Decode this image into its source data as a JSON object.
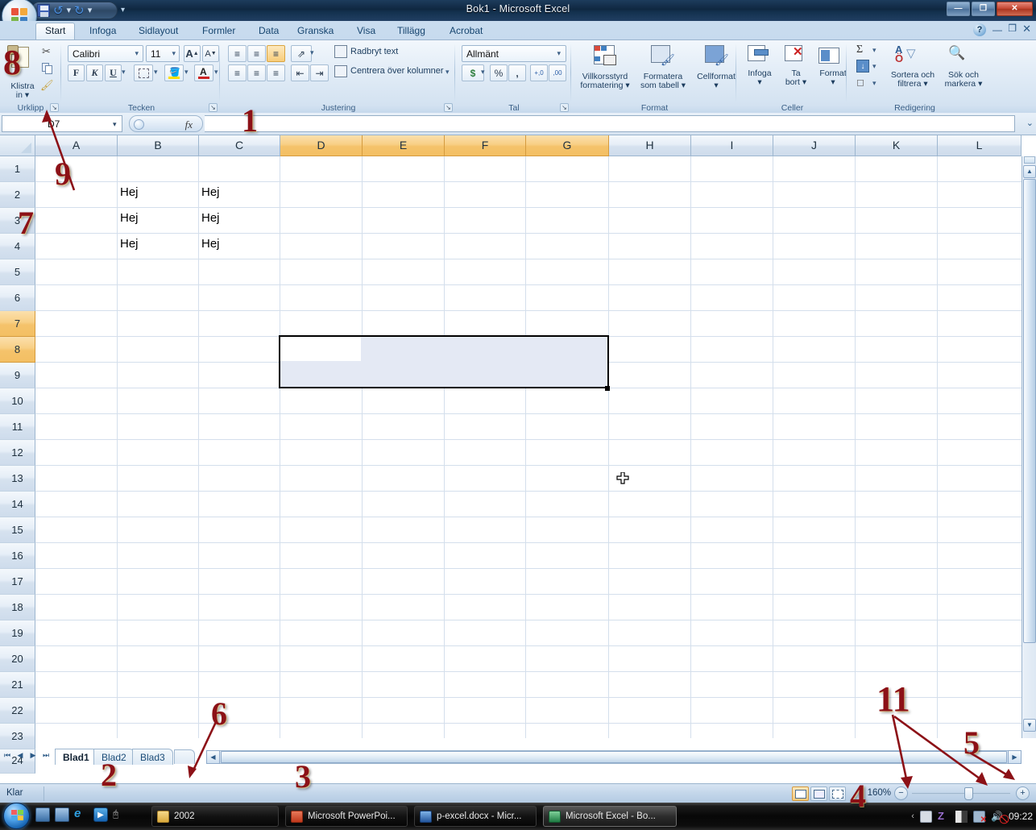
{
  "window": {
    "title": "Bok1 - Microsoft Excel",
    "minimize": "—",
    "restore": "❐",
    "close": "✕"
  },
  "quick_access": {
    "office_button": "Office-knappen",
    "save": "save-icon",
    "undo": "undo-icon",
    "redo": "redo-icon",
    "customize": "customize-icon"
  },
  "ribbon": {
    "tabs": [
      {
        "label": "Start",
        "active": true
      },
      {
        "label": "Infoga",
        "active": false
      },
      {
        "label": "Sidlayout",
        "active": false
      },
      {
        "label": "Formler",
        "active": false
      },
      {
        "label": "Data",
        "active": false
      },
      {
        "label": "Granska",
        "active": false
      },
      {
        "label": "Visa",
        "active": false
      },
      {
        "label": "Tillägg",
        "active": false
      },
      {
        "label": "Acrobat",
        "active": false
      }
    ],
    "help_icon": "?",
    "minimize_ribbon": "—",
    "restore_ribbon": "❐",
    "close_ribbon": "✕",
    "groups": [
      {
        "name": "Urklipp",
        "label": "Urklipp"
      },
      {
        "name": "Tecken",
        "label": "Tecken"
      },
      {
        "name": "Justering",
        "label": "Justering"
      },
      {
        "name": "Tal",
        "label": "Tal"
      },
      {
        "name": "Format",
        "label": "Format"
      },
      {
        "name": "Celler",
        "label": "Celler"
      },
      {
        "name": "Redigering",
        "label": "Redigering"
      }
    ],
    "clipboard": {
      "paste_line1": "Klistra",
      "paste_line2": "in",
      "cut": "cut-icon",
      "copy": "copy-icon",
      "format_painter": "format-painter-icon"
    },
    "font": {
      "font_name": "Calibri",
      "font_size": "11",
      "grow_font": "A",
      "shrink_font": "A",
      "bold": "F",
      "italic": "K",
      "underline": "U",
      "borders": "borders-icon",
      "fill_color": "fill-color-icon",
      "font_color": "A"
    },
    "alignment": {
      "wrap_text": "Radbryt text",
      "merge_center": "Centrera över kolumner",
      "orientation": "orientation-icon",
      "decrease_indent": "decrease-indent-icon",
      "increase_indent": "increase-indent-icon"
    },
    "number": {
      "format": "Allmänt",
      "currency": "$",
      "percent": "%",
      "comma": ",",
      "increase_decimals": "+,0",
      "decrease_decimals": ",00"
    },
    "styles": {
      "conditional_line1": "Villkorsstyrd",
      "conditional_line2": "formatering",
      "table_line1": "Formatera",
      "table_line2": "som tabell",
      "cell_styles": "Cellformat"
    },
    "cells": {
      "insert": "Infoga",
      "delete_line1": "Ta",
      "delete_line2": "bort",
      "format": "Format"
    },
    "editing": {
      "autosum": "Σ",
      "fill": "fill-icon",
      "clear": "clear-icon",
      "sort_line1": "Sortera och",
      "sort_line2": "filtrera",
      "find_line1": "Sök och",
      "find_line2": "markera"
    }
  },
  "formula_bar": {
    "name_box_value": "D7",
    "formula_value": "",
    "fx_label": "fx",
    "expand_icon": "⌄"
  },
  "grid": {
    "columns": [
      "A",
      "B",
      "C",
      "D",
      "E",
      "F",
      "G",
      "H",
      "I",
      "J",
      "K",
      "L"
    ],
    "highlighted_columns": [
      "D",
      "E",
      "F",
      "G"
    ],
    "rows": [
      "1",
      "2",
      "3",
      "4",
      "5",
      "6",
      "7",
      "8",
      "9",
      "10",
      "11",
      "12",
      "13",
      "14",
      "15",
      "16",
      "17",
      "18",
      "19",
      "20",
      "21",
      "22",
      "23",
      "24"
    ],
    "highlighted_rows": [
      "7",
      "8"
    ],
    "cells": [
      {
        "ref": "B2",
        "value": "Hej"
      },
      {
        "ref": "C2",
        "value": "Hej"
      },
      {
        "ref": "B3",
        "value": "Hej"
      },
      {
        "ref": "C3",
        "value": "Hej"
      },
      {
        "ref": "B4",
        "value": "Hej"
      },
      {
        "ref": "C4",
        "value": "Hej"
      }
    ],
    "selection_range": "D7:G8",
    "active_cell": "D7"
  },
  "sheet_tabs": {
    "first_icon": "⏮",
    "prev_icon": "◀",
    "next_icon": "▶",
    "last_icon": "⏭",
    "tabs": [
      {
        "label": "Blad1",
        "active": true
      },
      {
        "label": "Blad2",
        "active": false
      },
      {
        "label": "Blad3",
        "active": false
      }
    ],
    "new_sheet": "new-sheet-icon"
  },
  "status_bar": {
    "status": "Klar",
    "view_normal": "normal-view-icon",
    "view_page_layout": "page-layout-view-icon",
    "view_page_break": "page-break-view-icon",
    "zoom_level": "160%",
    "zoom_out": "−",
    "zoom_in": "+"
  },
  "taskbar": {
    "start": "start-orb-icon",
    "quick_launch": [
      "show-desktop-icon",
      "switch-windows-icon",
      "internet-explorer-icon",
      "media-player-icon",
      "mouse-icon"
    ],
    "buttons": [
      {
        "label": "2002",
        "icon": "folder-icon",
        "active": false
      },
      {
        "label": "Microsoft PowerPoi...",
        "icon": "powerpoint-icon",
        "active": false
      },
      {
        "label": "p-excel.docx - Micr...",
        "icon": "word-icon",
        "active": false
      },
      {
        "label": "Microsoft Excel - Bo...",
        "icon": "excel-icon",
        "active": true
      }
    ],
    "tray": [
      "show-hidden-icons",
      "antivirus-icon",
      "zonealarm-icon",
      "squares-icon",
      "network-disconnected-icon",
      "volume-muted-icon"
    ],
    "clock": "09:22"
  },
  "annotations": [
    {
      "id": "1",
      "label": "1"
    },
    {
      "id": "2",
      "label": "2"
    },
    {
      "id": "3",
      "label": "3"
    },
    {
      "id": "4",
      "label": "4"
    },
    {
      "id": "5",
      "label": "5"
    },
    {
      "id": "6",
      "label": "6"
    },
    {
      "id": "7",
      "label": "7"
    },
    {
      "id": "8",
      "label": "8"
    },
    {
      "id": "9",
      "label": "9"
    },
    {
      "id": "11",
      "label": "11"
    }
  ],
  "colors": {
    "annotation": "#8c1117",
    "header_highlight": "#f5c36b",
    "selection_fill": "#e4e9f4",
    "title_bar": "#12304d"
  }
}
